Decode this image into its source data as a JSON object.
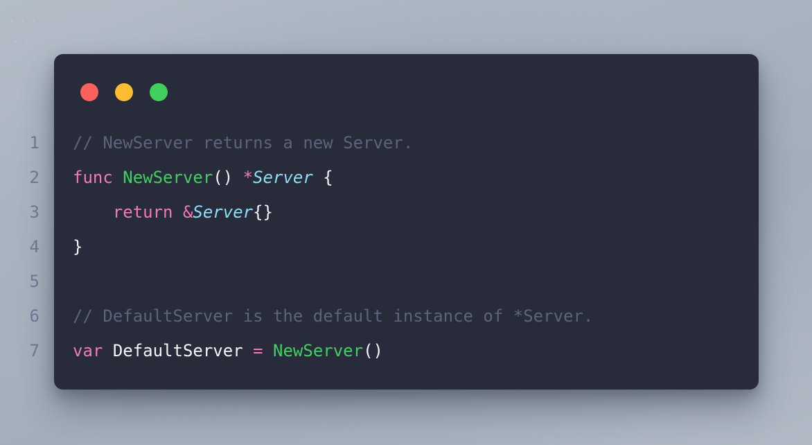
{
  "window": {
    "traffic_lights": [
      {
        "name": "close",
        "color": "#fc605c"
      },
      {
        "name": "minimize",
        "color": "#fdbd2e"
      },
      {
        "name": "maximize",
        "color": "#3fd15b"
      }
    ]
  },
  "theme": {
    "wallpaper": "#aab4c1",
    "card_background": "#282c3a",
    "gutter_color": "#6d7690",
    "comment": "#5b647a",
    "keyword": "#f379bc",
    "function": "#3fd160",
    "type": "#8ce0f5",
    "operator": "#f379bc",
    "plain": "#f2f4f8"
  },
  "editor": {
    "language": "Go",
    "lines": [
      {
        "number": "1",
        "text": "// NewServer returns a new Server.",
        "tokens": [
          {
            "t": "// NewServer returns a new Server.",
            "c": "comment"
          }
        ]
      },
      {
        "number": "2",
        "text": "func NewServer() *Server {",
        "tokens": [
          {
            "t": "func",
            "c": "keyword"
          },
          {
            "t": " ",
            "c": "plain"
          },
          {
            "t": "NewServer",
            "c": "function"
          },
          {
            "t": "()",
            "c": "punct"
          },
          {
            "t": " ",
            "c": "plain"
          },
          {
            "t": "*",
            "c": "operator"
          },
          {
            "t": "Server",
            "c": "type"
          },
          {
            "t": " {",
            "c": "punct"
          }
        ]
      },
      {
        "number": "3",
        "text": "    return &Server{}",
        "tokens": [
          {
            "t": "    ",
            "c": "plain"
          },
          {
            "t": "return",
            "c": "keyword"
          },
          {
            "t": " ",
            "c": "plain"
          },
          {
            "t": "&",
            "c": "operator"
          },
          {
            "t": "Server",
            "c": "type"
          },
          {
            "t": "{}",
            "c": "punct"
          }
        ]
      },
      {
        "number": "4",
        "text": "}",
        "tokens": [
          {
            "t": "}",
            "c": "punct"
          }
        ]
      },
      {
        "number": "5",
        "text": "",
        "tokens": []
      },
      {
        "number": "6",
        "text": "// DefaultServer is the default instance of *Server.",
        "tokens": [
          {
            "t": "// DefaultServer is the default instance of *Server.",
            "c": "comment"
          }
        ]
      },
      {
        "number": "7",
        "text": "var DefaultServer = NewServer()",
        "tokens": [
          {
            "t": "var",
            "c": "keyword"
          },
          {
            "t": " ",
            "c": "plain"
          },
          {
            "t": "DefaultServer",
            "c": "plain"
          },
          {
            "t": " ",
            "c": "plain"
          },
          {
            "t": "=",
            "c": "operator"
          },
          {
            "t": " ",
            "c": "plain"
          },
          {
            "t": "NewServer",
            "c": "function"
          },
          {
            "t": "()",
            "c": "punct"
          }
        ]
      }
    ]
  }
}
